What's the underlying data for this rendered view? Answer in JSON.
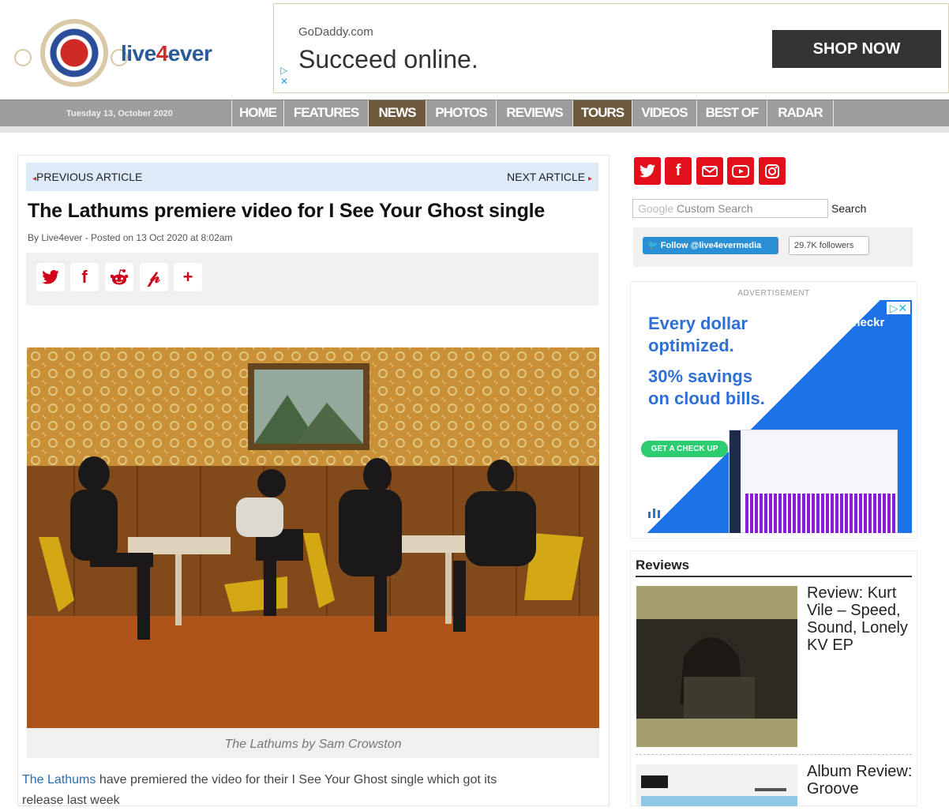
{
  "header": {
    "logo_text_main": "live",
    "logo_text_four": "4",
    "logo_text_end": "ever"
  },
  "top_ad": {
    "brand": "GoDaddy.com",
    "headline": "Succeed online.",
    "cta": "SHOP NOW"
  },
  "nav": {
    "date": "Tuesday 13, October 2020",
    "items": [
      {
        "label": "HOME",
        "active": false
      },
      {
        "label": "FEATURES",
        "active": false
      },
      {
        "label": "NEWS",
        "active": true
      },
      {
        "label": "PHOTOS",
        "active": false
      },
      {
        "label": "REVIEWS",
        "active": false
      },
      {
        "label": "TOURS",
        "active": true
      },
      {
        "label": "VIDEOS",
        "active": false
      },
      {
        "label": "BEST OF",
        "active": false
      },
      {
        "label": "RADAR",
        "active": false
      }
    ]
  },
  "article": {
    "prev_label": "PREVIOUS ARTICLE",
    "next_label": "NEXT ARTICLE",
    "title": "The Lathums premiere video for I See Your Ghost single",
    "byline": "By Live4ever - Posted on 13 Oct 2020 at 8:02am",
    "share_icons": [
      "twitter-icon",
      "facebook-icon",
      "reddit-icon",
      "pinterest-icon",
      "plus-icon"
    ],
    "caption": "The Lathums by Sam Crowston",
    "body_link": "The Lathums",
    "body_text_line1": " have premiered the video for their I See Your Ghost single which got its",
    "body_text_line2": "release last week"
  },
  "sidebar": {
    "social_icons": [
      "twitter-icon",
      "facebook-icon",
      "email-icon",
      "youtube-icon",
      "instagram-icon"
    ],
    "search_brand": "Google",
    "search_placeholder": "Custom Search",
    "search_button": "Search",
    "follow_button": "Follow @live4evermedia",
    "follower_count": "29.7K followers",
    "ad_label": "ADVERTISEMENT",
    "side_ad": {
      "line1a": "Every dollar",
      "line1b": "optimized.",
      "line2a": "30% savings",
      "line2b": "on cloud bills.",
      "brand": "CloudCheckr",
      "cta": "GET A CHECK UP"
    },
    "reviews_title": "Reviews",
    "reviews": [
      {
        "title": "Review: Kurt Vile – Speed, Sound, Lonely KV EP"
      },
      {
        "title": "Album Review: Groove"
      }
    ]
  }
}
